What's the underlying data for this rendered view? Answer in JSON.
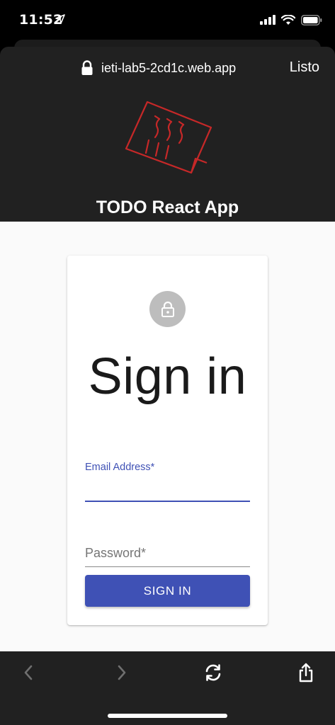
{
  "status_bar": {
    "time": "11:52",
    "icons": [
      "location-arrow-icon",
      "cellular-signal-icon",
      "wifi-icon",
      "battery-icon"
    ]
  },
  "browser": {
    "url": "ieti-lab5-2cd1c.web.app",
    "done_label": "Listo",
    "lock_icon": "lock-icon"
  },
  "header": {
    "title": "TODO React App",
    "logo_icon": "hot-note-logo",
    "logo_color": "#c62828"
  },
  "login": {
    "title": "Sign in",
    "avatar_icon": "lock-icon",
    "email_label": "Email Address*",
    "email_value": "",
    "password_placeholder": "Password*",
    "password_value": "",
    "submit_label": "SIGN IN",
    "accent_color": "#3f51b5"
  },
  "toolbar": {
    "items": [
      "back-icon",
      "forward-icon",
      "reload-icon",
      "share-icon"
    ]
  }
}
